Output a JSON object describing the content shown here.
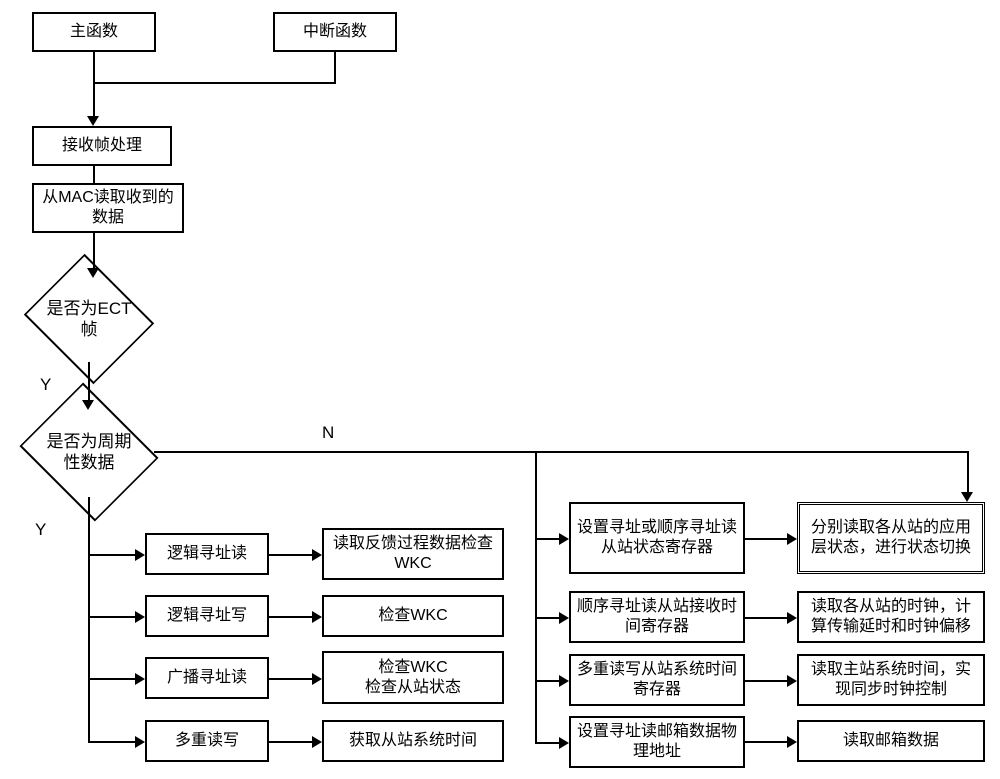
{
  "top": {
    "main": "主函数",
    "interrupt": "中断函数",
    "recv": "接收帧处理",
    "mac": "从MAC读取收到的数据"
  },
  "dec": {
    "ect": "是否为ECT帧",
    "cyc": "是否为周期性数据"
  },
  "lbl": {
    "y1": "Y",
    "y2": "Y",
    "n": "N"
  },
  "left": {
    "r1": "逻辑寻址读",
    "r2": "逻辑寻址写",
    "r3": "广播寻址读",
    "r4": "多重读写"
  },
  "mid": {
    "r1": "读取反馈过程数据检查WKC",
    "r2": "检查WKC",
    "r3": "检查WKC\n检查从站状态",
    "r4": "获取从站系统时间"
  },
  "rightA": {
    "r1": "设置寻址或顺序寻址读从站状态寄存器",
    "r2": "顺序寻址读从站接收时间寄存器",
    "r3": "多重读写从站系统时间寄存器",
    "r4": "设置寻址读邮箱数据物理地址"
  },
  "rightB": {
    "r1": "分别读取各从站的应用层状态，进行状态切换",
    "r2": "读取各从站的时钟，计算传输延时和时钟偏移",
    "r3": "读取主站系统时间，实现同步时钟控制",
    "r4": "读取邮箱数据"
  }
}
